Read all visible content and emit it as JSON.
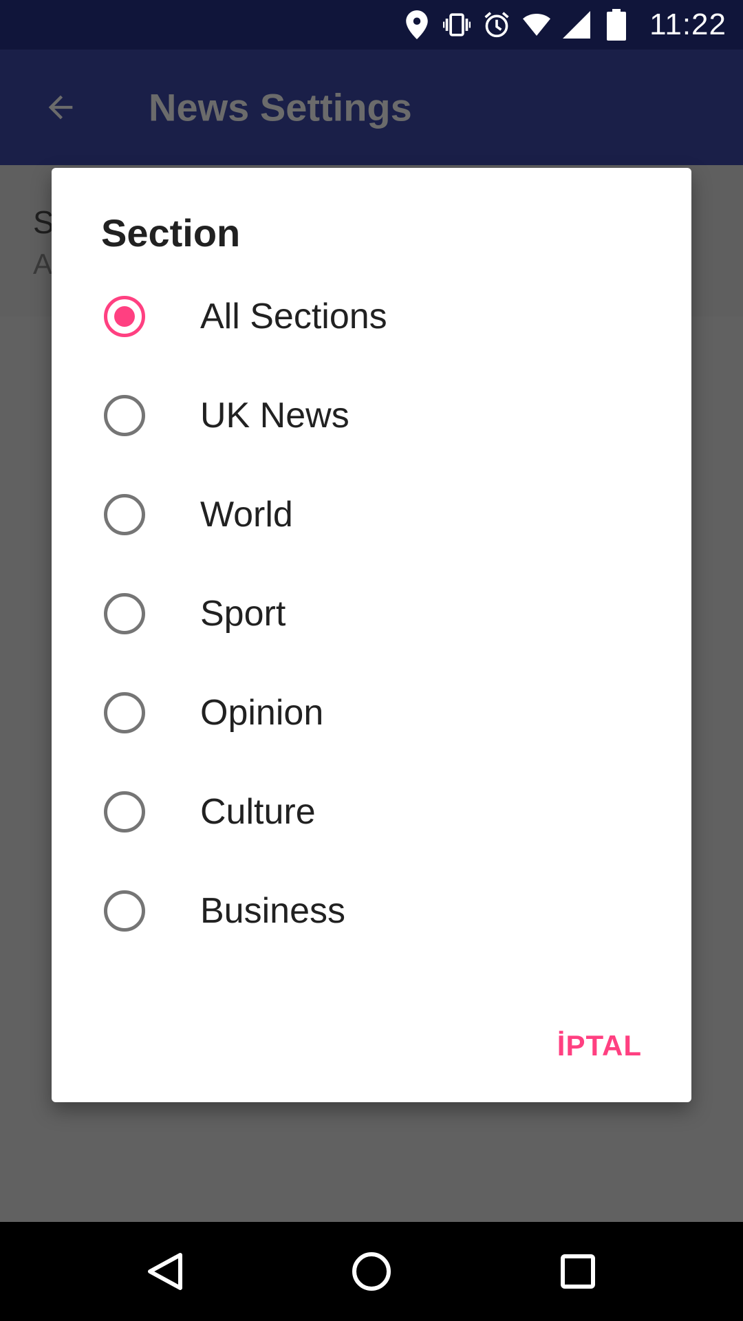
{
  "status_bar": {
    "time": "11:22",
    "icons": [
      "location-icon",
      "vibrate-icon",
      "alarm-icon",
      "wifi-icon",
      "signal-icon",
      "battery-icon"
    ]
  },
  "app_bar": {
    "title": "News Settings"
  },
  "background_setting": {
    "title_initial": "S",
    "summary_initial": "A"
  },
  "dialog": {
    "title": "Section",
    "options": [
      {
        "label": "All Sections",
        "selected": true
      },
      {
        "label": "UK News",
        "selected": false
      },
      {
        "label": "World",
        "selected": false
      },
      {
        "label": "Sport",
        "selected": false
      },
      {
        "label": "Opinion",
        "selected": false
      },
      {
        "label": "Culture",
        "selected": false
      },
      {
        "label": "Business",
        "selected": false
      }
    ],
    "cancel_label": "İPTAL"
  },
  "colors": {
    "accent": "#ff4081",
    "status_bar": "#10153a",
    "app_bar_dimmed": "#1a1f48"
  }
}
